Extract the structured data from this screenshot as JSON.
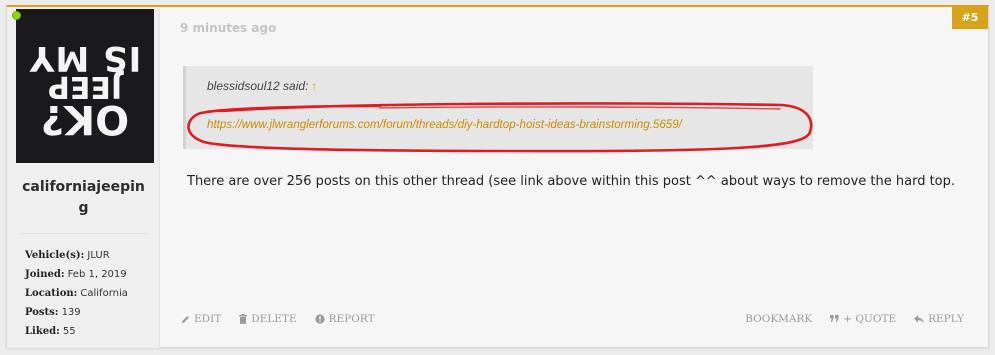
{
  "post": {
    "time_ago": "9 minutes ago",
    "number": "#5",
    "author": {
      "username": "californiajeeping",
      "avatar_text": [
        "OK?",
        "JEEP",
        "IS MY"
      ],
      "stats": [
        {
          "label": "Vehicle(s):",
          "value": "JLUR"
        },
        {
          "label": "Joined:",
          "value": "Feb 1, 2019"
        },
        {
          "label": "Location:",
          "value": "California"
        },
        {
          "label": "Posts:",
          "value": "139"
        },
        {
          "label": "Liked:",
          "value": "55"
        }
      ]
    },
    "quote": {
      "author_said": "blessidsoul12 said:",
      "jump_arrow": "↑",
      "link": "https://www.jlwranglerforums.com/forum/threads/diy-hardtop-hoist-ideas-brainstorming.5659/"
    },
    "body": "There are over 256 posts on this other thread (see link above within this post ^^ about ways to remove the hard top."
  },
  "actions": {
    "edit": "EDIT",
    "delete": "DELETE",
    "report": "REPORT",
    "bookmark": "BOOKMARK",
    "quote": "+ QUOTE",
    "reply": "REPLY"
  },
  "colors": {
    "accent": "#d9a21b",
    "link": "#c98a00",
    "highlight_stroke": "#e11b22",
    "online": "#8ed60f"
  }
}
